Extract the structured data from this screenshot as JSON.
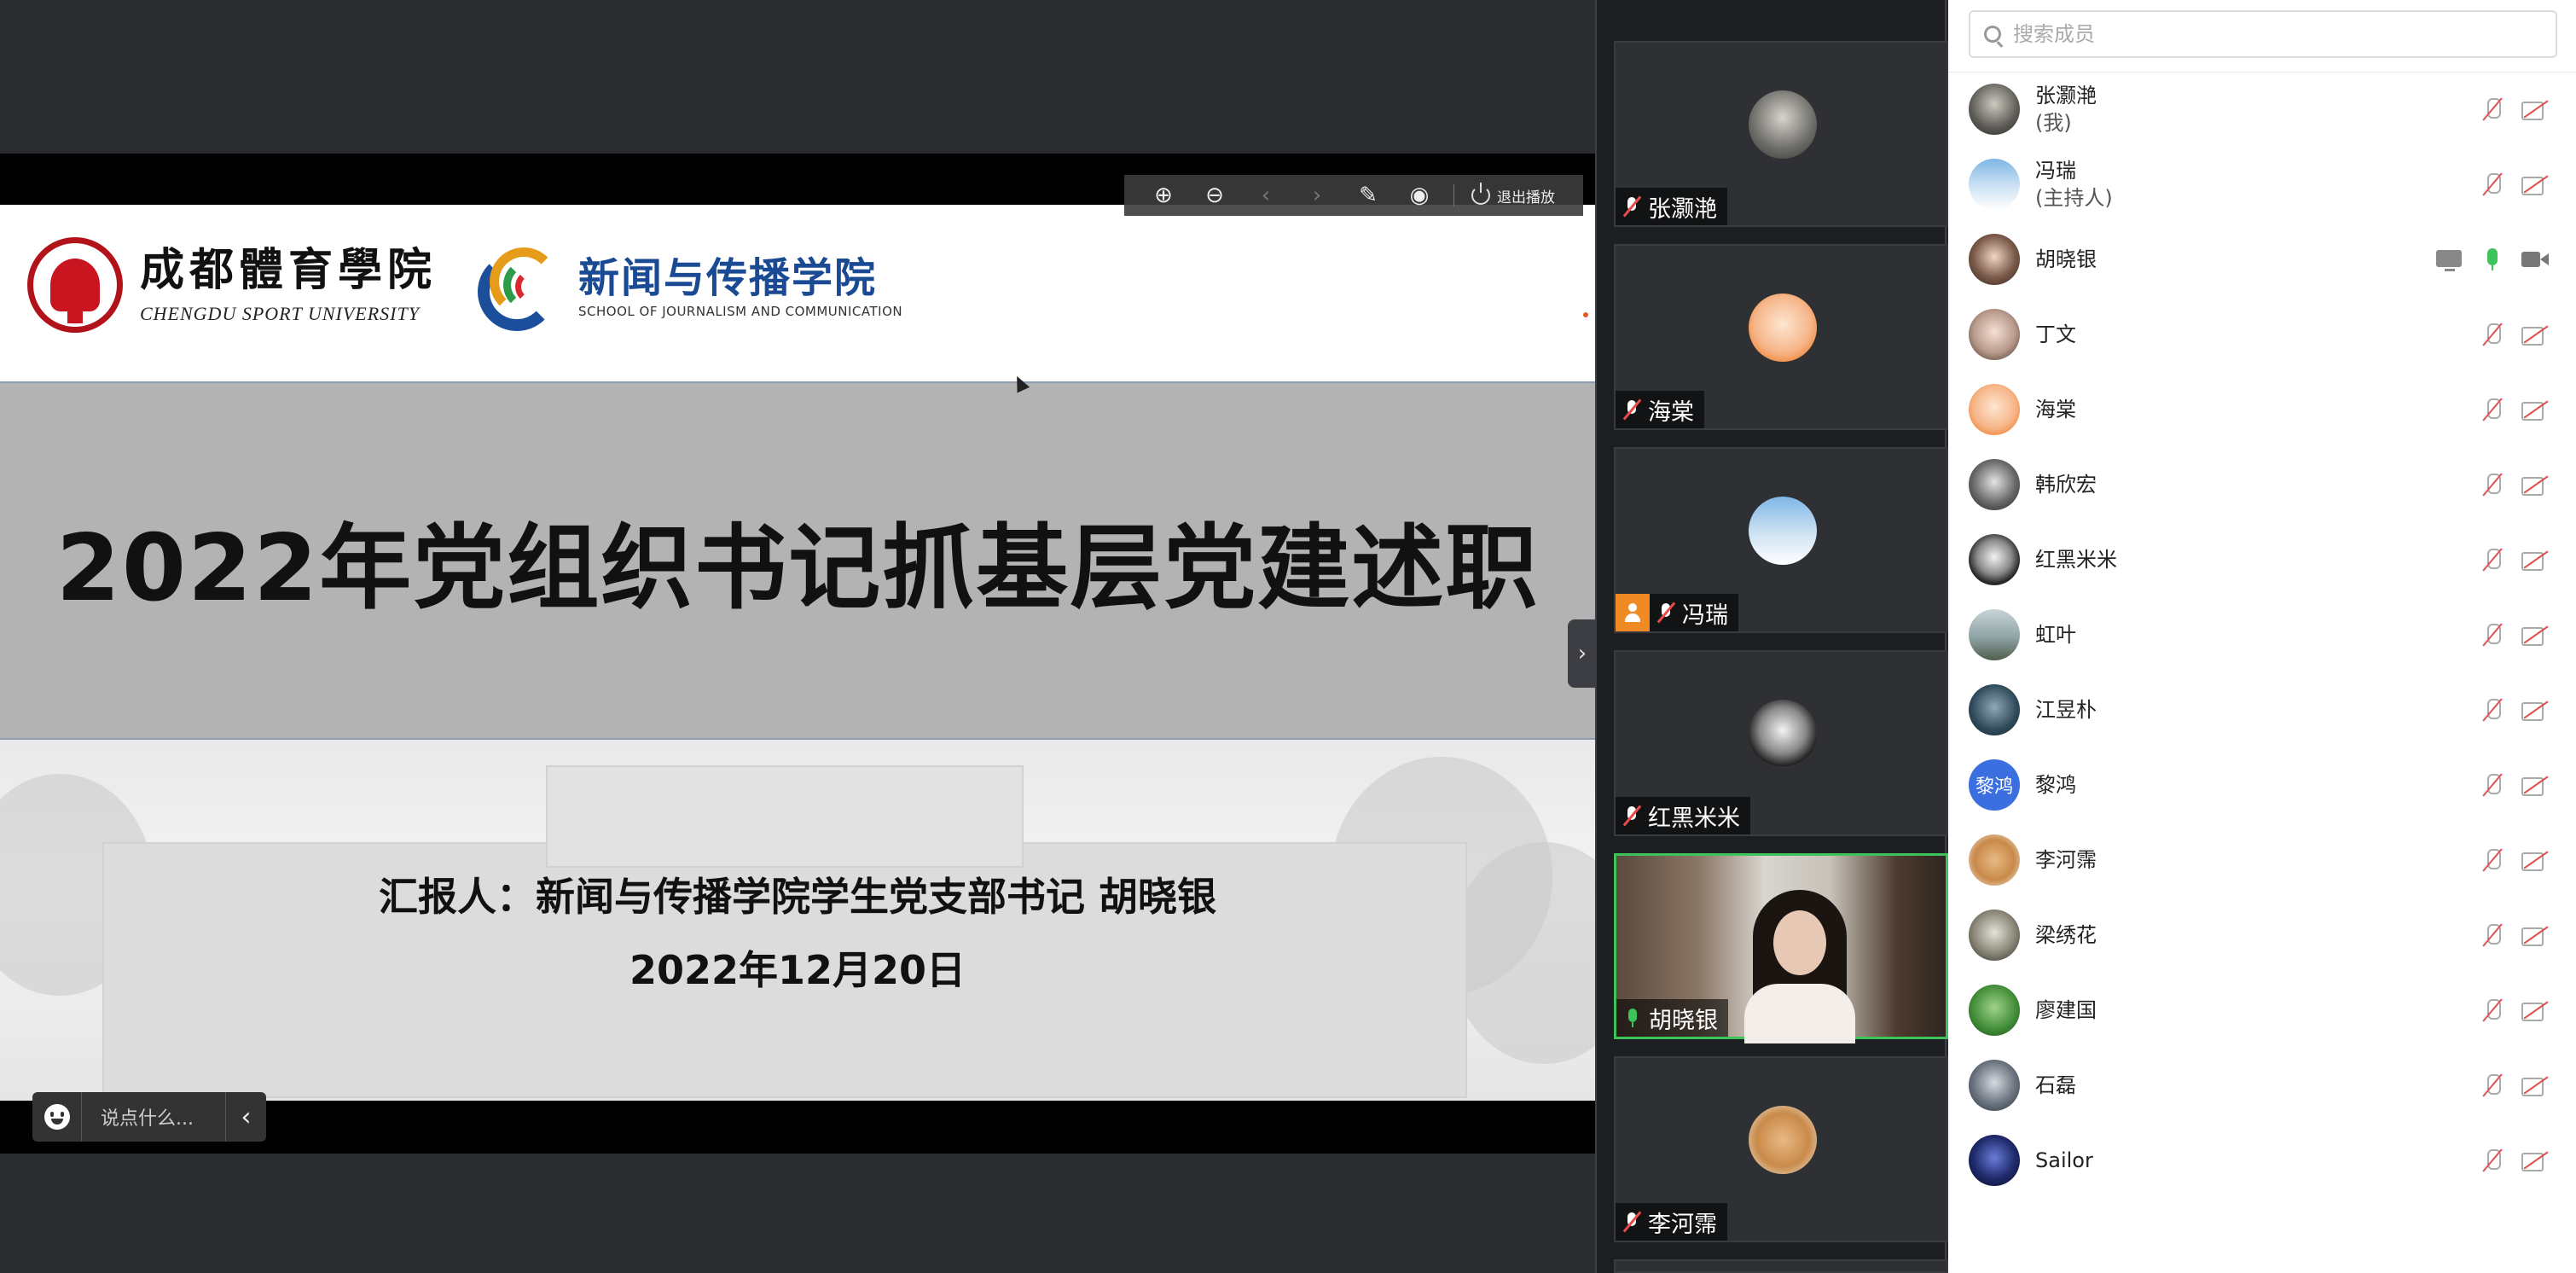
{
  "slide": {
    "cdsu_cn": "成都體育學院",
    "cdsu_en": "CHENGDU SPORT UNIVERSITY",
    "sjc_cn": "新闻与传播学院",
    "sjc_en": "SCHOOL OF JOURNALISM AND COMMUNICATION",
    "title": "2022年党组织书记抓基层党建述职",
    "reporter": "汇报人：新闻与传播学院学生党支部书记 胡晓银",
    "date": "2022年12月20日"
  },
  "toolbar": {
    "exit_label": "退出播放"
  },
  "chat": {
    "placeholder": "说点什么..."
  },
  "video_tiles": [
    {
      "name": "张灏滟",
      "mic": "off",
      "host": false
    },
    {
      "name": "海棠",
      "mic": "off",
      "host": false
    },
    {
      "name": "冯瑞",
      "mic": "off",
      "host": true
    },
    {
      "name": "红黑米米",
      "mic": "off",
      "host": false
    },
    {
      "name": "胡晓银",
      "mic": "on",
      "host": false
    },
    {
      "name": "李河霈",
      "mic": "off",
      "host": false
    }
  ],
  "members": {
    "search_placeholder": "搜索成员",
    "list": [
      {
        "name": "张灏滟",
        "role": "(我)",
        "mic": "off",
        "cam": "off"
      },
      {
        "name": "冯瑞",
        "role": "(主持人)",
        "mic": "off",
        "cam": "off"
      },
      {
        "name": "胡晓银",
        "role": "",
        "mic": "on",
        "cam": "on",
        "sharing": true
      },
      {
        "name": "丁文",
        "role": "",
        "mic": "off",
        "cam": "off"
      },
      {
        "name": "海棠",
        "role": "",
        "mic": "off",
        "cam": "off"
      },
      {
        "name": "韩欣宏",
        "role": "",
        "mic": "off",
        "cam": "off"
      },
      {
        "name": "红黑米米",
        "role": "",
        "mic": "off",
        "cam": "off"
      },
      {
        "name": "虹叶",
        "role": "",
        "mic": "off",
        "cam": "off"
      },
      {
        "name": "江昱朴",
        "role": "",
        "mic": "off",
        "cam": "off"
      },
      {
        "name": "黎鸿",
        "role": "",
        "mic": "off",
        "cam": "off",
        "avatar_text": "黎鸿"
      },
      {
        "name": "李河霈",
        "role": "",
        "mic": "off",
        "cam": "off"
      },
      {
        "name": "梁绣花",
        "role": "",
        "mic": "off",
        "cam": "off"
      },
      {
        "name": "廖建国",
        "role": "",
        "mic": "off",
        "cam": "off"
      },
      {
        "name": "石磊",
        "role": "",
        "mic": "off",
        "cam": "off"
      },
      {
        "name": "Sailor",
        "role": "",
        "mic": "off",
        "cam": "off"
      }
    ]
  },
  "colors": {
    "accent_green": "#3dc35a",
    "host_orange": "#f08a24",
    "mute_red": "#e05050",
    "letter_avatar_blue": "#3b6fe0"
  }
}
